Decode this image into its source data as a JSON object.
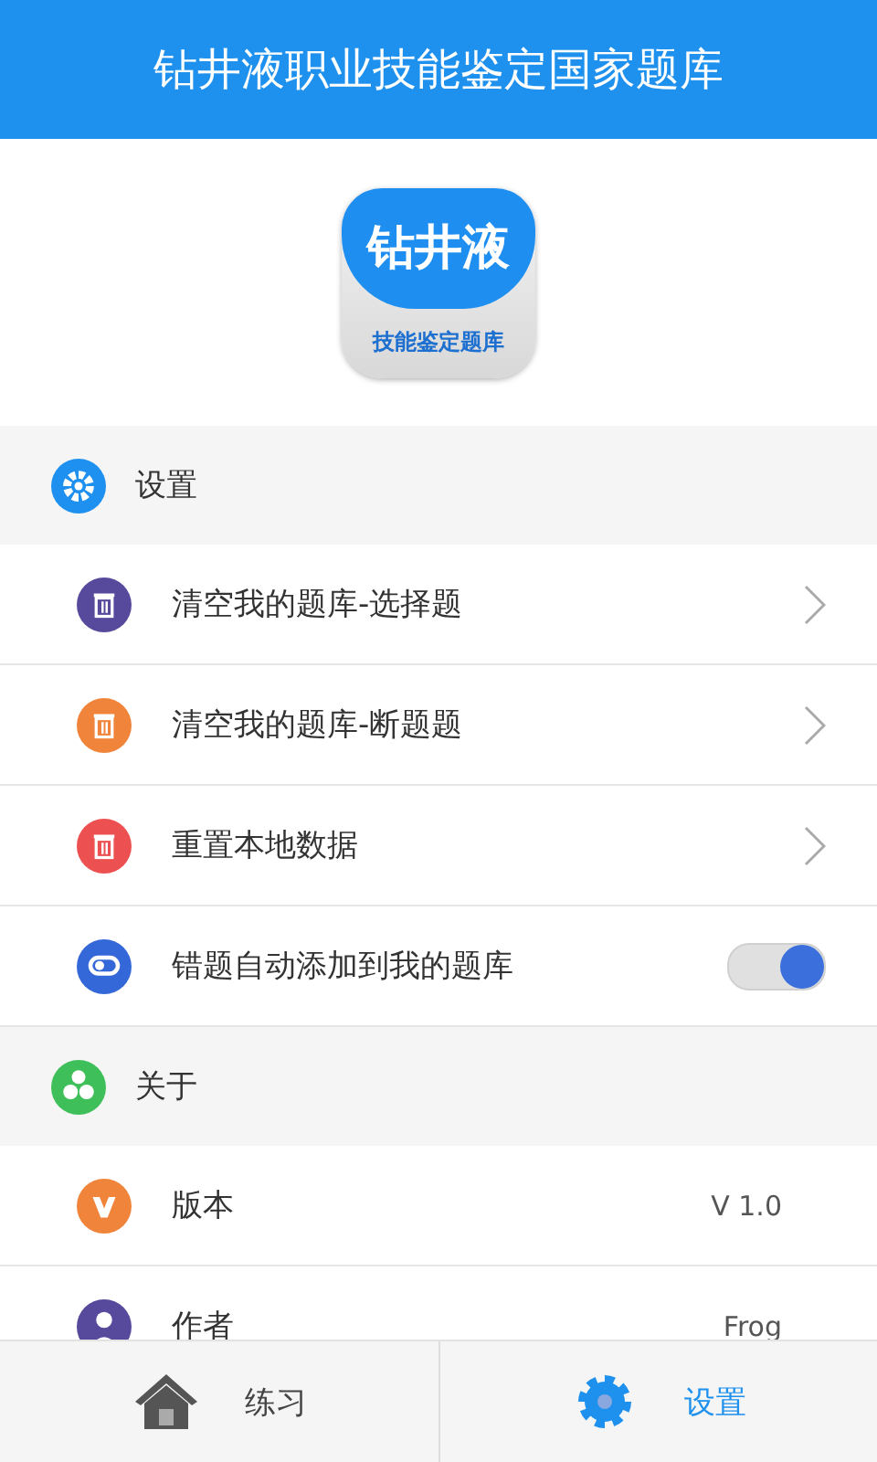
{
  "header": {
    "title": "钻井液职业技能鉴定国家题库"
  },
  "logo": {
    "top_text": "钻井液",
    "bottom_text": "技能鉴定题库"
  },
  "sections": [
    {
      "title": "设置",
      "color": "#1e90f0",
      "items": [
        {
          "label": "清空我的题库-选择题",
          "color": "#574a9c",
          "kind": "chevron"
        },
        {
          "label": "清空我的题库-断题题",
          "color": "#f0843a",
          "kind": "chevron"
        },
        {
          "label": "重置本地数据",
          "color": "#ec5050",
          "kind": "chevron"
        },
        {
          "label": "错题自动添加到我的题库",
          "color": "#3468d8",
          "kind": "switch",
          "on": true
        }
      ]
    },
    {
      "title": "关于",
      "color": "#3fbf5a",
      "items": [
        {
          "label": "版本",
          "color": "#f0843a",
          "kind": "value",
          "value": "V 1.0"
        },
        {
          "label": "作者",
          "color": "#574a9c",
          "kind": "value",
          "value": "Frog"
        }
      ]
    }
  ],
  "tabs": [
    {
      "label": "练习",
      "selected": false
    },
    {
      "label": "设置",
      "selected": true
    }
  ]
}
